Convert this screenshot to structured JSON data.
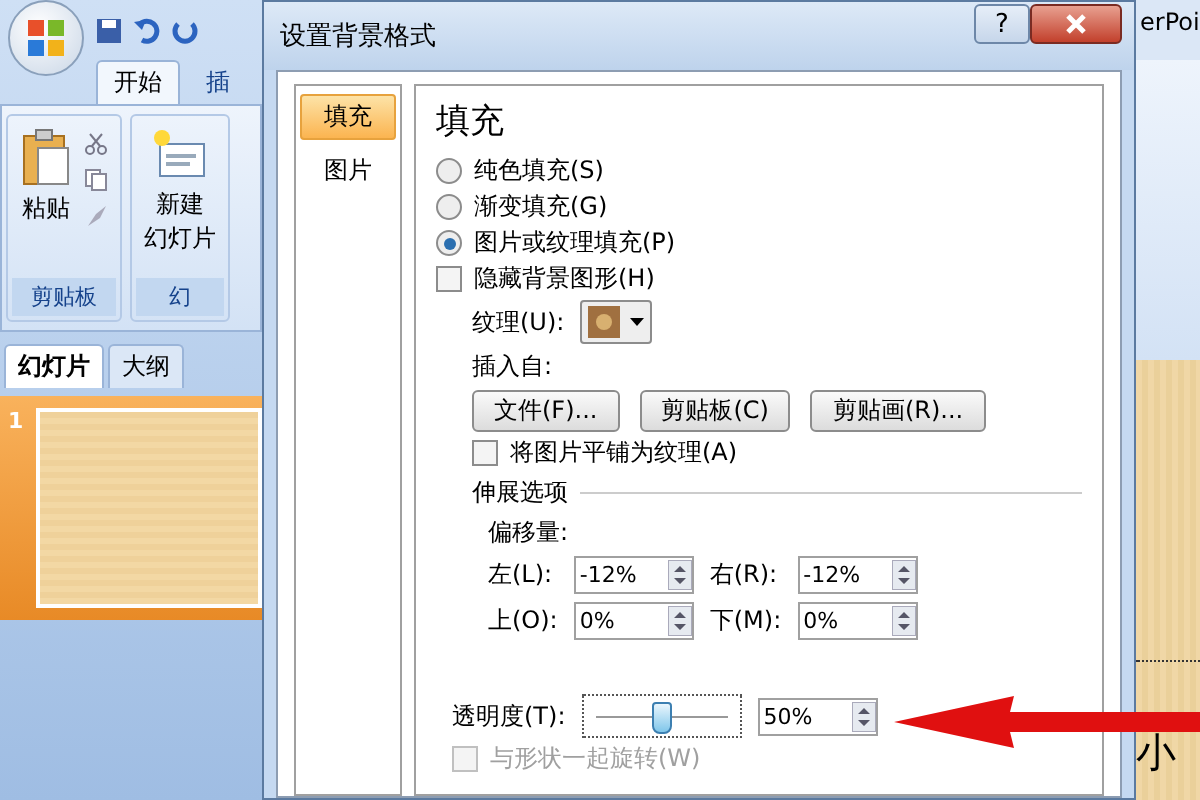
{
  "app": {
    "tabs": [
      {
        "label": "开始",
        "selected": true
      },
      {
        "label": "插",
        "selected": false
      }
    ],
    "ribbon_groups": [
      {
        "label": "剪贴板",
        "button": [
          "粘贴"
        ],
        "kind": "paste"
      },
      {
        "label": "幻",
        "button": [
          "新建",
          "幻灯片"
        ],
        "kind": "new-slide"
      }
    ],
    "pane_tabs": [
      {
        "label": "幻灯片",
        "selected": true
      },
      {
        "label": "大纲",
        "selected": false
      }
    ],
    "slide_number": "1",
    "title_fragment": "erPoi",
    "slide_text": "小"
  },
  "dialog": {
    "title": "设置背景格式",
    "help": "?",
    "nav": [
      {
        "label": "填充",
        "selected": true
      },
      {
        "label": "图片",
        "selected": false
      }
    ],
    "heading": "填充",
    "fill_options": [
      {
        "label": "纯色填充(S)",
        "selected": false
      },
      {
        "label": "渐变填充(G)",
        "selected": false
      },
      {
        "label": "图片或纹理填充(P)",
        "selected": true
      }
    ],
    "hide_background": {
      "label": "隐藏背景图形(H)",
      "checked": false
    },
    "texture_label": "纹理(U):",
    "insert_from": "插入自:",
    "buttons": [
      "文件(F)...",
      "剪贴板(C)",
      "剪贴画(R)..."
    ],
    "tile": {
      "label": "将图片平铺为纹理(A)",
      "checked": false
    },
    "stretch_heading": "伸展选项",
    "offset_label": "偏移量:",
    "offsets": [
      {
        "label": "左(L):",
        "value": "-12%"
      },
      {
        "label": "右(R):",
        "value": "-12%"
      },
      {
        "label": "上(O):",
        "value": "0%"
      },
      {
        "label": "下(M):",
        "value": "0%"
      }
    ],
    "transparency": {
      "label": "透明度(T):",
      "level": 0.5,
      "value": "50%"
    },
    "rotate": {
      "label": "与形状一起旋转(W)",
      "checked": false,
      "disabled": true
    }
  }
}
